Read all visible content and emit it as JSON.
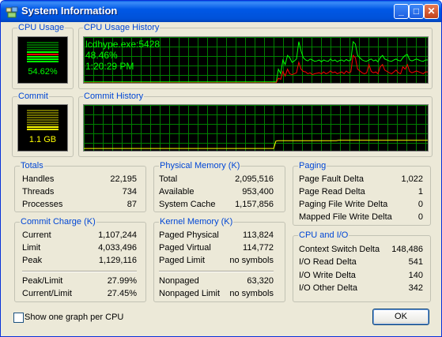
{
  "window": {
    "title": "System Information",
    "icon": "system-info-icon"
  },
  "titlebar_buttons": {
    "minimize": "_",
    "maximize": "□",
    "close": "✕"
  },
  "cpu_usage": {
    "label": "CPU Usage",
    "value": "54.62%",
    "level": 0.5462
  },
  "cpu_history": {
    "label": "CPU Usage History",
    "tooltip_process": "lcdhype.exe:5428",
    "tooltip_percent": "48.46%",
    "tooltip_time": "1:20:29 PM",
    "total_series": [
      2,
      2,
      2,
      2,
      2,
      2,
      2,
      2,
      2,
      2,
      2,
      2,
      2,
      2,
      2,
      2,
      2,
      2,
      2,
      2,
      2,
      2,
      2,
      2,
      2,
      2,
      2,
      2,
      2,
      2,
      2,
      2,
      2,
      2,
      2,
      2,
      2,
      2,
      2,
      2,
      2,
      2,
      2,
      2,
      2,
      2,
      2,
      2,
      2,
      2,
      2,
      2,
      2,
      2,
      2,
      2,
      2,
      2,
      2,
      2,
      2,
      2,
      2,
      2,
      2,
      2,
      2,
      2,
      2,
      2,
      2,
      2,
      2,
      2,
      2,
      2,
      2,
      2,
      2,
      2,
      2,
      2,
      2,
      2,
      2,
      2,
      30,
      20,
      50,
      40,
      60,
      55,
      45,
      48,
      52,
      90,
      70,
      55,
      50,
      48,
      52,
      50,
      47,
      48,
      50,
      46,
      50,
      48,
      47,
      52,
      48,
      50,
      46,
      49,
      50,
      47,
      51,
      48,
      50,
      90,
      85,
      60,
      55,
      50,
      48,
      47,
      50,
      52,
      48,
      50,
      46,
      55,
      60,
      52,
      50,
      48,
      47,
      50,
      52,
      49,
      48,
      55,
      60,
      62,
      50,
      48,
      50,
      52,
      50,
      48,
      47,
      50,
      50
    ],
    "kernel_series": [
      0,
      0,
      0,
      0,
      0,
      0,
      0,
      0,
      0,
      0,
      0,
      0,
      0,
      0,
      0,
      0,
      0,
      0,
      0,
      0,
      0,
      0,
      0,
      0,
      0,
      0,
      0,
      0,
      0,
      0,
      0,
      0,
      0,
      0,
      0,
      0,
      0,
      0,
      0,
      0,
      0,
      0,
      0,
      0,
      0,
      0,
      0,
      0,
      0,
      0,
      0,
      0,
      0,
      0,
      0,
      0,
      0,
      0,
      0,
      0,
      0,
      0,
      0,
      0,
      0,
      0,
      0,
      0,
      0,
      0,
      0,
      0,
      0,
      0,
      0,
      0,
      0,
      0,
      0,
      0,
      0,
      0,
      0,
      0,
      0,
      0,
      10,
      8,
      25,
      15,
      30,
      20,
      18,
      20,
      22,
      45,
      30,
      25,
      24,
      20,
      22,
      18,
      20,
      21,
      22,
      20,
      24,
      20,
      22,
      26,
      22,
      24,
      20,
      22,
      24,
      20,
      26,
      22,
      24,
      60,
      55,
      30,
      26,
      22,
      20,
      22,
      40,
      25,
      22,
      24,
      20,
      35,
      40,
      28,
      25,
      22,
      20,
      24,
      28,
      22,
      20,
      35,
      30,
      40,
      25,
      22,
      24,
      26,
      24,
      22,
      20,
      24,
      24
    ]
  },
  "commit": {
    "label": "Commit",
    "value": "1.1 GB",
    "level": 0.27
  },
  "commit_history": {
    "label": "Commit History",
    "series": [
      0.05,
      0.05,
      0.05,
      0.05,
      0.05,
      0.05,
      0.05,
      0.05,
      0.05,
      0.05,
      0.05,
      0.05,
      0.05,
      0.05,
      0.05,
      0.05,
      0.05,
      0.05,
      0.05,
      0.05,
      0.05,
      0.05,
      0.05,
      0.05,
      0.05,
      0.05,
      0.05,
      0.05,
      0.05,
      0.05,
      0.05,
      0.05,
      0.05,
      0.05,
      0.05,
      0.05,
      0.05,
      0.05,
      0.05,
      0.05,
      0.05,
      0.05,
      0.05,
      0.05,
      0.05,
      0.05,
      0.05,
      0.05,
      0.05,
      0.05,
      0.05,
      0.05,
      0.05,
      0.05,
      0.05,
      0.05,
      0.05,
      0.05,
      0.05,
      0.05,
      0.05,
      0.05,
      0.05,
      0.05,
      0.05,
      0.05,
      0.05,
      0.05,
      0.05,
      0.05,
      0.05,
      0.05,
      0.05,
      0.05,
      0.05,
      0.05,
      0.05,
      0.05,
      0.05,
      0.05,
      0.05,
      0.05,
      0.05,
      0.05,
      0.05,
      0.05,
      0.21,
      0.22,
      0.22,
      0.22,
      0.22,
      0.22,
      0.22,
      0.22,
      0.22,
      0.22,
      0.22,
      0.22,
      0.22,
      0.22,
      0.22,
      0.22,
      0.22,
      0.22,
      0.22,
      0.22,
      0.22,
      0.22,
      0.22,
      0.22,
      0.22,
      0.22,
      0.22,
      0.22,
      0.23,
      0.23,
      0.23,
      0.23,
      0.23,
      0.23,
      0.23,
      0.23,
      0.23,
      0.23,
      0.23,
      0.23,
      0.23,
      0.23,
      0.23,
      0.23,
      0.23,
      0.23,
      0.23,
      0.23,
      0.23,
      0.23,
      0.23,
      0.23,
      0.23,
      0.23,
      0.23,
      0.23,
      0.23,
      0.23,
      0.23,
      0.23,
      0.23,
      0.23,
      0.23,
      0.23,
      0.23,
      0.23,
      0.23,
      0.23,
      0.23
    ]
  },
  "totals": {
    "label": "Totals",
    "rows": [
      {
        "key": "Handles",
        "value": "22,195"
      },
      {
        "key": "Threads",
        "value": "734"
      },
      {
        "key": "Processes",
        "value": "87"
      }
    ]
  },
  "physical_memory": {
    "label": "Physical Memory (K)",
    "rows": [
      {
        "key": "Total",
        "value": "2,095,516"
      },
      {
        "key": "Available",
        "value": "953,400"
      },
      {
        "key": "System Cache",
        "value": "1,157,856"
      }
    ]
  },
  "paging": {
    "label": "Paging",
    "rows": [
      {
        "key": "Page Fault Delta",
        "value": "1,022"
      },
      {
        "key": "Page Read Delta",
        "value": "1"
      },
      {
        "key": "Paging File Write Delta",
        "value": "0"
      },
      {
        "key": "Mapped File Write Delta",
        "value": "0"
      }
    ]
  },
  "commit_charge": {
    "label": "Commit Charge (K)",
    "rows": [
      {
        "key": "Current",
        "value": "1,107,244"
      },
      {
        "key": "Limit",
        "value": "4,033,496"
      },
      {
        "key": "Peak",
        "value": "1,129,116"
      }
    ],
    "ratios": [
      {
        "key": "Peak/Limit",
        "value": "27.99%"
      },
      {
        "key": "Current/Limit",
        "value": "27.45%"
      }
    ]
  },
  "kernel_memory": {
    "label": "Kernel Memory (K)",
    "rows": [
      {
        "key": "Paged Physical",
        "value": "113,824"
      },
      {
        "key": "Paged Virtual",
        "value": "114,772"
      },
      {
        "key": "Paged Limit",
        "value": "no symbols"
      }
    ],
    "rows2": [
      {
        "key": "Nonpaged",
        "value": "63,320"
      },
      {
        "key": "Nonpaged Limit",
        "value": "no symbols"
      }
    ]
  },
  "cpu_io": {
    "label": "CPU and I/O",
    "rows": [
      {
        "key": "Context Switch Delta",
        "value": "148,486"
      },
      {
        "key": "I/O Read Delta",
        "value": "541"
      },
      {
        "key": "I/O Write Delta",
        "value": "140"
      },
      {
        "key": "I/O Other Delta",
        "value": "342"
      }
    ]
  },
  "footer": {
    "checkbox_label": "Show one graph per CPU",
    "checkbox_checked": false,
    "ok_label": "OK"
  },
  "colors": {
    "graph_grid": "#008000",
    "cpu_total": "#00ff00",
    "cpu_kernel": "#ff0000",
    "commit_line": "#ffff00",
    "label_blue": "#0046d5"
  }
}
